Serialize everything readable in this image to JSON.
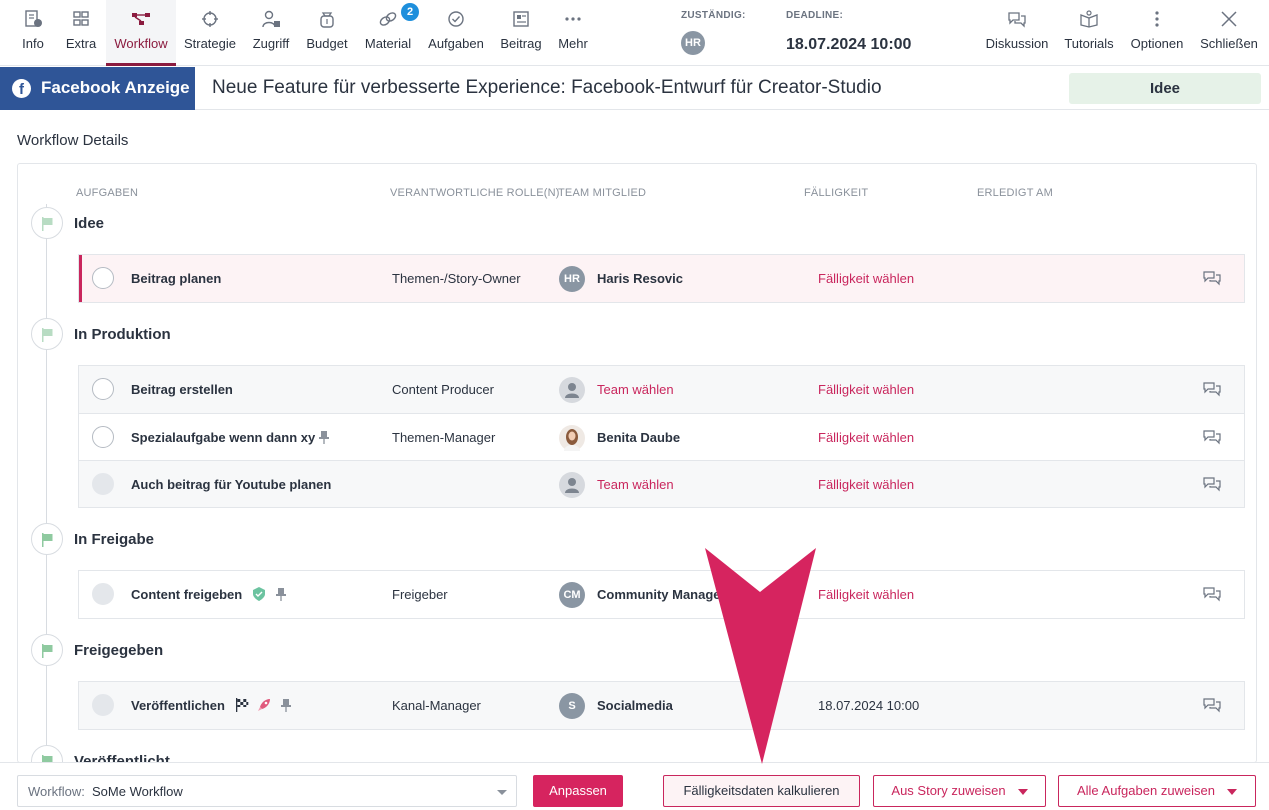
{
  "toolbar": {
    "items": [
      {
        "label": "Info",
        "icon": "document-info-icon"
      },
      {
        "label": "Extra",
        "icon": "grid-icon"
      },
      {
        "label": "Workflow",
        "icon": "workflow-icon",
        "active": true
      },
      {
        "label": "Strategie",
        "icon": "crosshair-icon"
      },
      {
        "label": "Zugriff",
        "icon": "user-lock-icon"
      },
      {
        "label": "Budget",
        "icon": "money-bag-icon"
      },
      {
        "label": "Material",
        "icon": "link-icon",
        "badge": "2"
      },
      {
        "label": "Aufgaben",
        "icon": "check-circle-icon"
      },
      {
        "label": "Beitrag",
        "icon": "newspaper-icon"
      },
      {
        "label": "Mehr",
        "icon": "more-dots-icon"
      }
    ],
    "assignee_label": "ZUSTÄNDIG:",
    "assignee_initials": "HR",
    "deadline_label": "DEADLINE:",
    "deadline_value": "18.07.2024 10:00",
    "right_items": [
      {
        "label": "Diskussion",
        "icon": "chat-bubbles-icon"
      },
      {
        "label": "Tutorials",
        "icon": "open-book-icon"
      },
      {
        "label": "Optionen",
        "icon": "kebab-menu-icon"
      },
      {
        "label": "Schließen",
        "icon": "close-icon"
      }
    ]
  },
  "titlebar": {
    "channel": "Facebook Anzeige",
    "channel_icon": "f",
    "title": "Neue Feature für verbesserte Experience: Facebook-Entwurf für Creator-Studio",
    "status": "Idee"
  },
  "section_title": "Workflow Details",
  "columns": [
    "AUFGABEN",
    "VERANTWORTLICHE ROLLE(N)",
    "TEAM MITGLIED",
    "FÄLLIGKEIT",
    "ERLEDIGT AM"
  ],
  "stages": [
    {
      "name": "Idee",
      "tasks": [
        {
          "name": "Beitrag planen",
          "role": "Themen-/Story-Owner",
          "avatar": "HR",
          "member": "Haris Resovic",
          "due": "Fälligkeit wählen"
        }
      ]
    },
    {
      "name": "In Produktion",
      "tasks": [
        {
          "name": "Beitrag erstellen",
          "role": "Content Producer",
          "member": "Team wählen",
          "due": "Fälligkeit wählen"
        },
        {
          "name": "Spezialaufgabe wenn dann xy",
          "role": "Themen-Manager",
          "member": "Benita Daube",
          "due": "Fälligkeit wählen"
        },
        {
          "name": "Auch beitrag für Youtube planen",
          "role": "",
          "member": "Team wählen",
          "due": "Fälligkeit wählen"
        }
      ]
    },
    {
      "name": "In Freigabe",
      "tasks": [
        {
          "name": "Content freigeben",
          "role": "Freigeber",
          "avatar": "CM",
          "member": "Community Manager",
          "due": "Fälligkeit wählen"
        }
      ]
    },
    {
      "name": "Freigegeben",
      "tasks": [
        {
          "name": "Veröffentlichen",
          "role": "Kanal-Manager",
          "avatar": "S",
          "member": "Socialmedia",
          "due": "18.07.2024 10:00"
        }
      ]
    },
    {
      "name": "Veröffentlicht",
      "tasks": []
    }
  ],
  "bottom": {
    "workflow_label": "Workflow:",
    "workflow_value": "SoMe Workflow",
    "adjust": "Anpassen",
    "calc_due": "Fälligkeitsdaten kalkulieren",
    "assign_story": "Aus Story zuweisen",
    "assign_all": "Alle Aufgaben zuweisen"
  },
  "colors": {
    "accent": "#c9265d",
    "brand_blue": "#2f5597",
    "active_tab": "#8b1b3f",
    "status_bg": "#e6f2e8",
    "badge": "#1e8fdc",
    "stage_flag": "#b8dcc3"
  }
}
